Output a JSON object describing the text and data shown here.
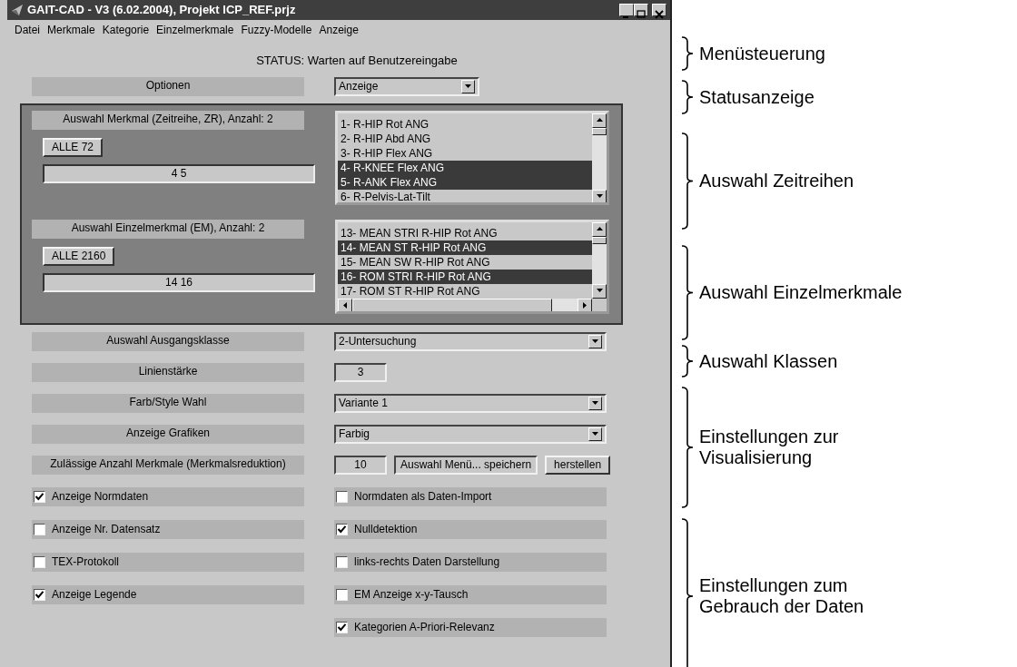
{
  "window": {
    "title": "GAIT-CAD - V3 (6.02.2004), Projekt ICP_REF.prjz"
  },
  "menu": [
    "Datei",
    "Merkmale",
    "Kategorie",
    "Einzelmerkmale",
    "Fuzzy-Modelle",
    "Anzeige"
  ],
  "status": "STATUS: Warten auf Benutzereingabe",
  "options": {
    "label": "Optionen",
    "value": "Anzeige"
  },
  "panels": [
    {
      "label": "Auswahl Merkmal (Zeitreihe, ZR), Anzahl: 2",
      "button": "ALLE 72",
      "value": "4 5",
      "hscroll": false,
      "items": [
        {
          "text": "1- R-HIP Rot ANG",
          "selected": false
        },
        {
          "text": "2- R-HIP Abd ANG",
          "selected": false
        },
        {
          "text": "3- R-HIP Flex ANG",
          "selected": false
        },
        {
          "text": "4- R-KNEE Flex ANG",
          "selected": true
        },
        {
          "text": "5- R-ANK Flex ANG",
          "selected": true
        },
        {
          "text": "6- R-Pelvis-Lat-Tilt",
          "selected": false
        }
      ]
    },
    {
      "label": "Auswahl Einzelmerkmal (EM), Anzahl: 2",
      "button": "ALLE 2160",
      "value": "14 16",
      "hscroll": true,
      "items": [
        {
          "text": "13-  MEAN STRI R-HIP Rot ANG",
          "selected": false
        },
        {
          "text": "14-  MEAN ST R-HIP Rot ANG",
          "selected": true
        },
        {
          "text": "15-  MEAN SW R-HIP Rot ANG",
          "selected": false
        },
        {
          "text": "16-  ROM STRI R-HIP Rot ANG",
          "selected": true
        },
        {
          "text": "17-  ROM ST R-HIP Rot ANG",
          "selected": false
        }
      ]
    }
  ],
  "settings": [
    {
      "label": "Auswahl Ausgangsklasse",
      "kind": "dropdown",
      "value": "2-Untersuchung"
    },
    {
      "label": "Linienstärke",
      "kind": "field",
      "value": "3"
    },
    {
      "label": "Farb/Style Wahl",
      "kind": "dropdown",
      "value": "Variante 1"
    },
    {
      "label": "Anzeige Grafiken",
      "kind": "dropdown",
      "value": "Farbig"
    },
    {
      "label": "Zulässige Anzahl Merkmale (Merkmalsreduktion)",
      "kind": "field_buttons",
      "value": "10",
      "menu_field": "Auswahl Menü... speichern",
      "button": "herstellen"
    }
  ],
  "checkboxes_left": [
    {
      "label": "Anzeige Normdaten",
      "checked": true
    },
    {
      "label": "Anzeige Nr. Datensatz",
      "checked": false
    },
    {
      "label": "TEX-Protokoll",
      "checked": false
    },
    {
      "label": "Anzeige Legende",
      "checked": true
    }
  ],
  "checkboxes_right": [
    {
      "label": "Normdaten als Daten-Import",
      "checked": false
    },
    {
      "label": "Nulldetektion",
      "checked": true
    },
    {
      "label": "links-rechts Daten Darstellung",
      "checked": false
    },
    {
      "label": "EM Anzeige x-y-Tausch",
      "checked": false
    },
    {
      "label": "Kategorien A-Priori-Relevanz",
      "checked": true
    }
  ],
  "annotations": [
    {
      "text": "Menüsteuerung"
    },
    {
      "text": "Statusanzeige"
    },
    {
      "text": "Auswahl Zeitreihen"
    },
    {
      "text": "Auswahl Einzelmerkmale"
    },
    {
      "text": "Auswahl Klassen"
    },
    {
      "text": "Einstellungen zur Visualisierung"
    },
    {
      "text": "Einstellungen zum Gebrauch der Daten"
    }
  ]
}
